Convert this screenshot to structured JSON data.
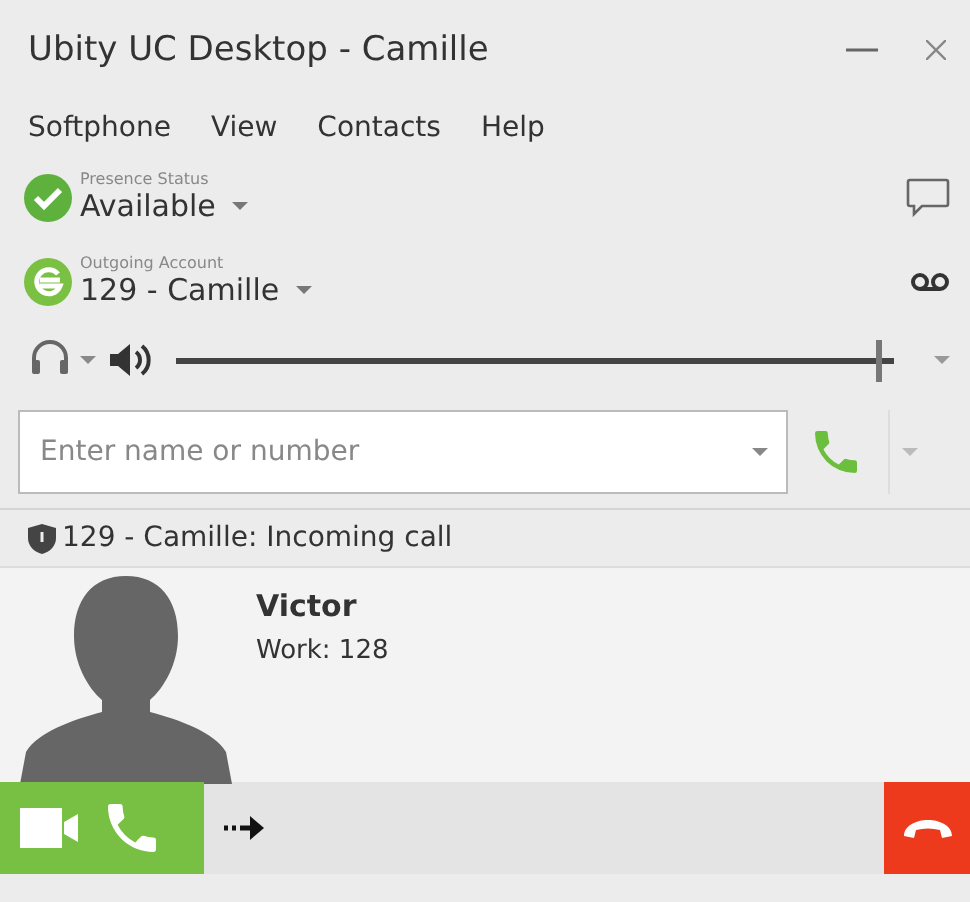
{
  "window": {
    "title": "Ubity UC Desktop - Camille"
  },
  "menu": [
    "Softphone",
    "View",
    "Contacts",
    "Help"
  ],
  "presence": {
    "label": "Presence Status",
    "value": "Available"
  },
  "account": {
    "label": "Outgoing Account",
    "value": "129 - Camille"
  },
  "volume": {
    "level": 0.98
  },
  "dial": {
    "placeholder": "Enter name or number"
  },
  "call": {
    "header": "129 - Camille: Incoming call",
    "name": "Victor",
    "detail": "Work: 128"
  }
}
